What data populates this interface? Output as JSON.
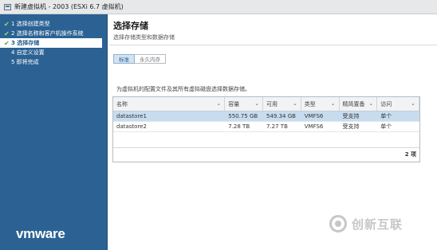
{
  "window": {
    "title": "新建虚拟机 - 2003 (ESXi 6.7 虚拟机)"
  },
  "sidebar": {
    "steps": [
      {
        "label": "1 选择创建类型",
        "done": true
      },
      {
        "label": "2 选择名称和客户机操作系统",
        "done": true
      },
      {
        "label": "3 选择存储",
        "done": true,
        "active": true
      },
      {
        "label": "4 自定义设置",
        "done": false
      },
      {
        "label": "5 即将完成",
        "done": false
      }
    ],
    "brand": "vmware"
  },
  "main": {
    "title": "选择存储",
    "subtitle": "选择存储类型和数据存储",
    "toggle": {
      "standard": "标准",
      "persistent": "永久内存"
    },
    "description": "为虚拟机的配置文件及其所有虚拟磁盘选择数据存储。",
    "table": {
      "columns": [
        "名称",
        "容量",
        "可用",
        "类型",
        "精简置备",
        "访问"
      ],
      "rows": [
        {
          "name": "datastore1",
          "capacity": "550.75 GB",
          "free": "549.34 GB",
          "type": "VMFS6",
          "thin": "受支持",
          "access": "单个"
        },
        {
          "name": "datastore2",
          "capacity": "7.28 TB",
          "free": "7.27 TB",
          "type": "VMFS6",
          "thin": "受支持",
          "access": "单个"
        }
      ],
      "count": "2 项"
    }
  },
  "watermark": "创新互联",
  "colors": {
    "sidebar": "#2b6293",
    "selected_row": "#c7dcef",
    "check": "#9fe06a"
  }
}
